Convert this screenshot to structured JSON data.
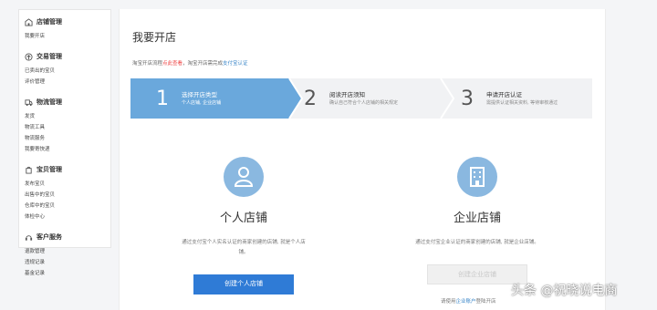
{
  "sidebar": {
    "groups": [
      {
        "icon": "shop-icon",
        "title": "店铺管理",
        "links": [
          "我要开店"
        ]
      },
      {
        "icon": "trade-icon",
        "title": "交易管理",
        "links": [
          "已卖出的宝贝",
          "评价管理"
        ]
      },
      {
        "icon": "logistics-icon",
        "title": "物流管理",
        "links": [
          "发货",
          "物流工具",
          "物流服务",
          "我要寄快递"
        ]
      },
      {
        "icon": "goods-icon",
        "title": "宝贝管理",
        "links": [
          "发布宝贝",
          "出售中的宝贝",
          "仓库中的宝贝",
          "体检中心"
        ]
      },
      {
        "icon": "service-icon",
        "title": "客户服务",
        "links": [
          "退款管理",
          "违规记录",
          "基金记录"
        ]
      }
    ]
  },
  "main": {
    "title": "我要开店",
    "notice_prefix": "淘宝开店流程",
    "notice_red": "点此查看",
    "notice_mid": "，淘宝开店需完成",
    "notice_blue": "支付宝认证"
  },
  "steps": [
    {
      "number": "1",
      "title": "选择开店类型",
      "desc": "个人店铺, 企业店铺",
      "state": "active"
    },
    {
      "number": "2",
      "title": "阅读开店须知",
      "desc": "确认自己符合个人店铺的相关规定",
      "state": "inactive"
    },
    {
      "number": "3",
      "title": "申请开店认证",
      "desc": "需提供认证相关资料, 等待审核通过",
      "state": "inactive"
    }
  ],
  "cards": {
    "personal": {
      "icon": "person-icon",
      "title": "个人店铺",
      "desc": "通过支付宝个人实名认证的商家创建的店铺, 就是个人店铺。",
      "button": "创建个人店铺"
    },
    "enterprise": {
      "icon": "building-icon",
      "title": "企业店铺",
      "desc": "通过支付宝企业认证的商家创建的店铺, 就是企业店铺。",
      "button": "创建企业店铺",
      "tip_prefix": "请使用",
      "tip_link": "企业账户",
      "tip_suffix": "登陆开店"
    }
  },
  "watermark": "头条 @祝晓说电商",
  "colors": {
    "accent": "#6aa8dc",
    "primary_button": "#2f7bd6",
    "icon_circle": "#8ab8e0",
    "notice_red": "#e44444"
  }
}
